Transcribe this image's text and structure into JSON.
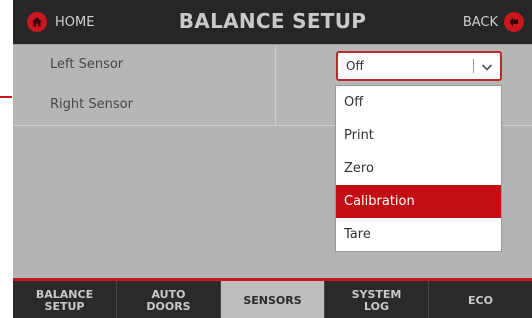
{
  "header": {
    "home_label": "HOME",
    "home_icon": "home-icon",
    "title": "BALANCE SETUP",
    "back_label": "BACK",
    "back_icon": "arrow-back-icon"
  },
  "rows": [
    {
      "label": "Left Sensor",
      "value": "Off"
    },
    {
      "label": "Right Sensor"
    }
  ],
  "select": {
    "value": "Off",
    "arrow_icon": "chevron-down-icon"
  },
  "dropdown": {
    "options": [
      "Off",
      "Print",
      "Zero",
      "Calibration",
      "Tare"
    ],
    "highlighted": "Calibration"
  },
  "nav": {
    "tabs": [
      {
        "label": "BALANCE\nSETUP",
        "active": false
      },
      {
        "label": "AUTO\nDOORS",
        "active": false
      },
      {
        "label": "SENSORS",
        "active": true
      },
      {
        "label": "SYSTEM\nLOG",
        "active": false
      },
      {
        "label": "ECO",
        "active": false
      }
    ]
  },
  "colors": {
    "accent": "#c8181e",
    "header_bg": "#262626",
    "panel_bg": "#b3b3b3",
    "highlight": "#c10e14"
  }
}
